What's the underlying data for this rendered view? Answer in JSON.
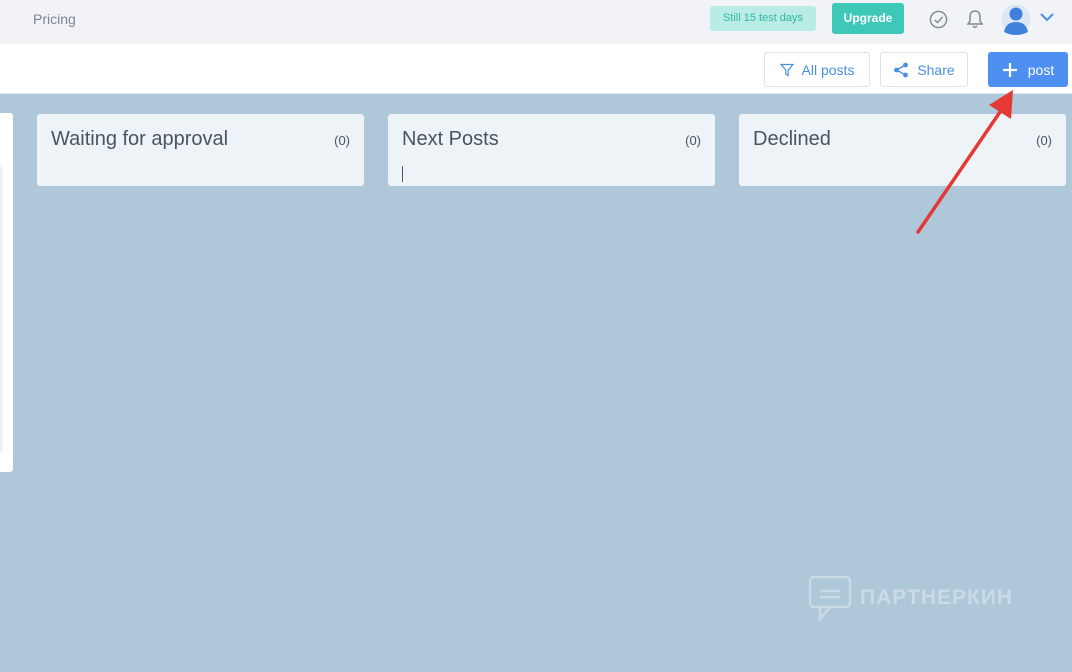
{
  "topbar": {
    "nav_pricing": "Pricing",
    "trial_badge": "Still 15 test days",
    "upgrade_label": "Upgrade"
  },
  "toolbar": {
    "filter_label": "All posts",
    "share_label": "Share",
    "new_post_label": "post"
  },
  "columns": [
    {
      "title": "Waiting for approval",
      "count": "(0)"
    },
    {
      "title": "Next Posts",
      "count": "(0)"
    },
    {
      "title": "Declined",
      "count": "(0)"
    }
  ],
  "watermark": {
    "text": "ПАРТНЕРКИН"
  },
  "colors": {
    "background": "#aec8da",
    "accent_blue": "#4e8ff2",
    "teal": "#3ec8b7",
    "annotation_arrow": "#e53935"
  },
  "icons": {
    "check": "check-circle-icon",
    "bell": "bell-icon",
    "avatar": "user-avatar",
    "chevron": "chevron-down-icon",
    "filter": "filter-icon",
    "share": "share-icon",
    "plus": "plus-icon"
  }
}
